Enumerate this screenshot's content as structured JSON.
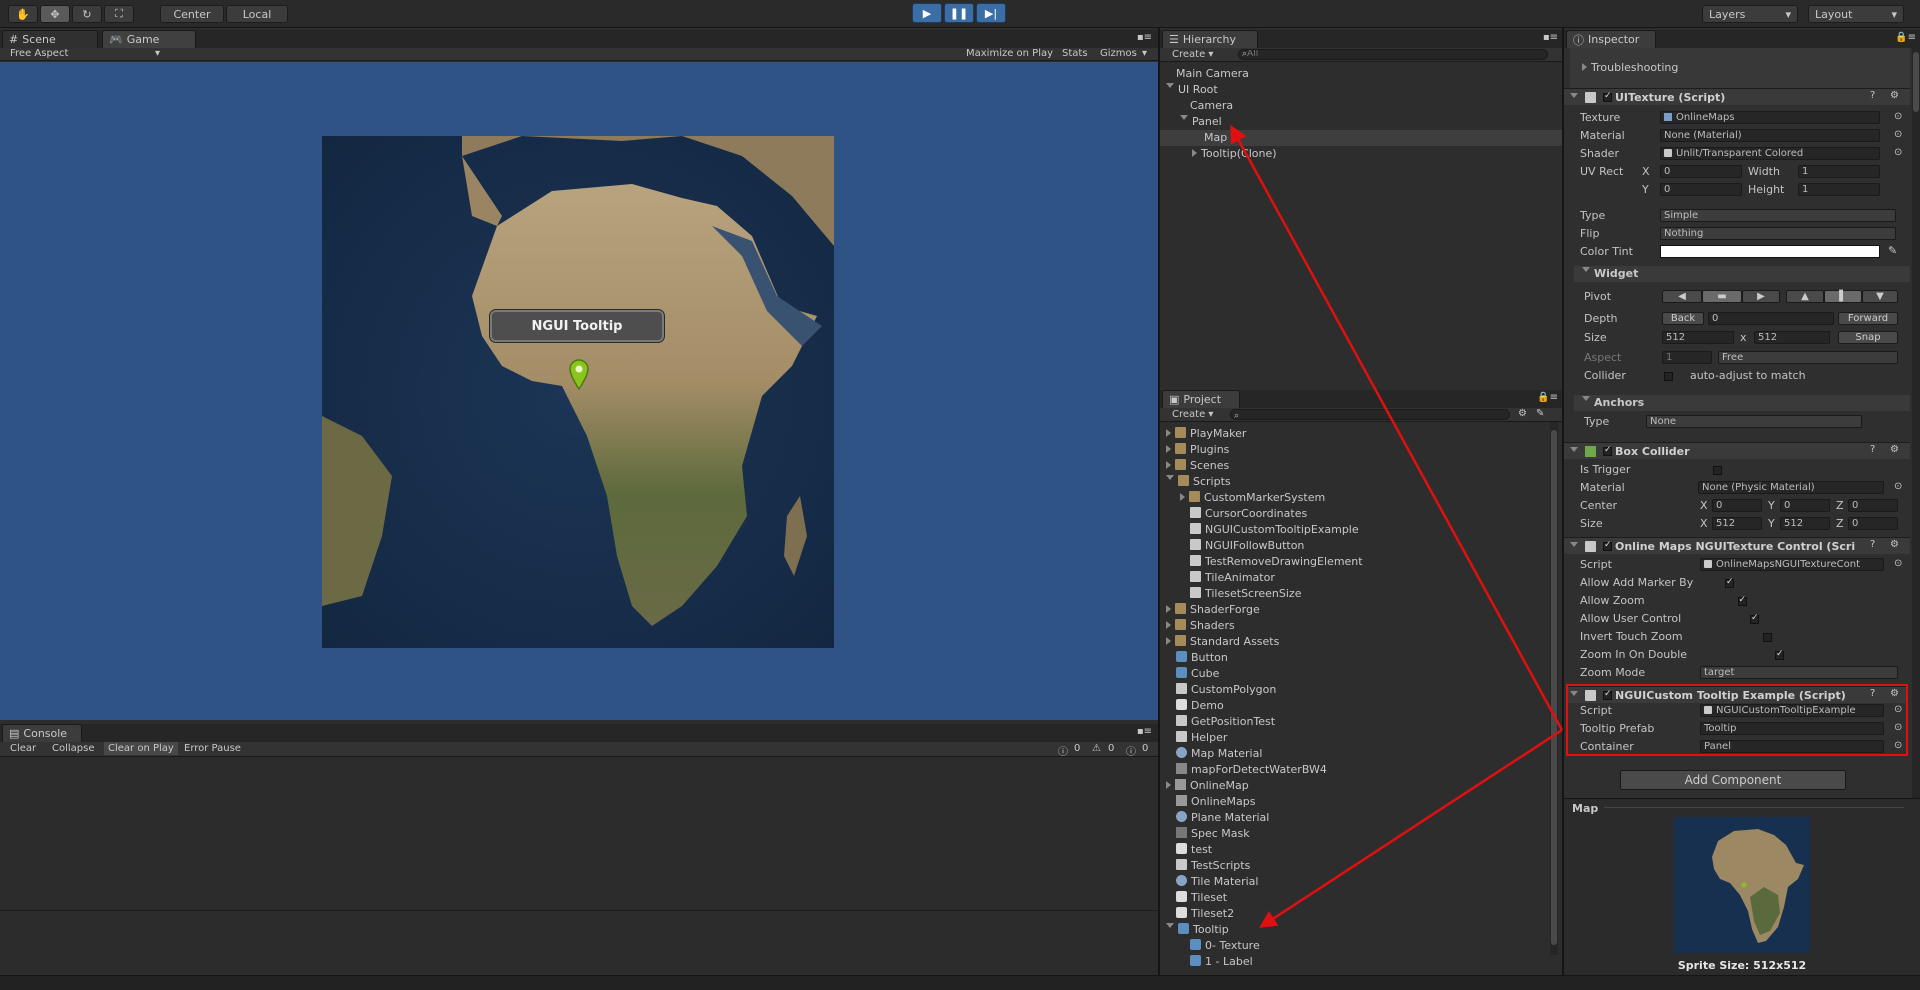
{
  "toolbar": {
    "center": "Center",
    "local": "Local",
    "layers": "Layers",
    "layout": "Layout"
  },
  "scene": {
    "tab_scene": "Scene",
    "tab_game": "Game",
    "aspect": "Free Aspect",
    "maximize": "Maximize on Play",
    "stats": "Stats",
    "gizmos": "Gizmos",
    "tooltip": "NGUI Tooltip"
  },
  "console": {
    "tab": "Console",
    "clear": "Clear",
    "collapse": "Collapse",
    "clear_on_play": "Clear on Play",
    "error_pause": "Error Pause",
    "count_log": "0",
    "count_warn": "0",
    "count_err": "0"
  },
  "hierarchy": {
    "tab": "Hierarchy",
    "create": "Create",
    "search_placeholder": "All",
    "items": [
      "Main Camera",
      "UI Root",
      "Camera",
      "Panel",
      "Map",
      "Tooltip(Clone)"
    ]
  },
  "project": {
    "tab": "Project",
    "create": "Create",
    "items": [
      "PlayMaker",
      "Plugins",
      "Scenes",
      "Scripts",
      "CustomMarkerSystem",
      "CursorCoordinates",
      "NGUICustomTooltipExample",
      "NGUIFollowButton",
      "TestRemoveDrawingElement",
      "TileAnimator",
      "TilesetScreenSize",
      "ShaderForge",
      "Shaders",
      "Standard Assets",
      "Button",
      "Cube",
      "CustomPolygon",
      "Demo",
      "GetPositionTest",
      "Helper",
      "Map Material",
      "mapForDetectWaterBW4",
      "OnlineMap",
      "OnlineMaps",
      "Plane Material",
      "Spec Mask",
      "test",
      "TestScripts",
      "Tile Material",
      "Tileset",
      "Tileset2",
      "Tooltip",
      "0- Texture",
      "1 - Label"
    ]
  },
  "inspector": {
    "tab": "Inspector",
    "troubleshooting": "Troubleshooting",
    "uitexture": {
      "title": "UITexture (Script)",
      "texture_l": "Texture",
      "texture_v": "OnlineMaps",
      "material_l": "Material",
      "material_v": "None (Material)",
      "shader_l": "Shader",
      "shader_v": "Unlit/Transparent Colored",
      "uvrect_l": "UV Rect",
      "x_l": "X",
      "x_v": "0",
      "y_l": "Y",
      "y_v": "0",
      "w_l": "Width",
      "w_v": "1",
      "h_l": "Height",
      "h_v": "1",
      "type_l": "Type",
      "type_v": "Simple",
      "flip_l": "Flip",
      "flip_v": "Nothing",
      "tint_l": "Color Tint"
    },
    "widget": {
      "title": "Widget",
      "pivot_l": "Pivot",
      "depth_l": "Depth",
      "back": "Back",
      "depth_v": "0",
      "forward": "Forward",
      "size_l": "Size",
      "size_w": "512",
      "x_sep": "x",
      "size_h": "512",
      "snap": "Snap",
      "aspect_l": "Aspect",
      "aspect_v": "1",
      "aspect_mode": "Free",
      "collider_l": "Collider",
      "collider_v": "auto-adjust to match"
    },
    "anchors": {
      "title": "Anchors",
      "type_l": "Type",
      "type_v": "None"
    },
    "box": {
      "title": "Box Collider",
      "trigger_l": "Is Trigger",
      "material_l": "Material",
      "material_v": "None (Physic Material)",
      "center_l": "Center",
      "size_l": "Size",
      "cx": "0",
      "cy": "0",
      "cz": "0",
      "sx": "512",
      "sy": "512",
      "sz": "0",
      "xl": "X",
      "yl": "Y",
      "zl": "Z"
    },
    "omc": {
      "title": "Online Maps NGUITexture Control (Scri",
      "script_l": "Script",
      "script_v": "OnlineMapsNGUITextureCont",
      "add_marker_l": "Allow Add Marker By",
      "allow_zoom_l": "Allow Zoom",
      "allow_user_l": "Allow User Control",
      "invert_l": "Invert Touch Zoom",
      "zoom_double_l": "Zoom In On Double",
      "zoom_mode_l": "Zoom Mode",
      "zoom_mode_v": "target"
    },
    "ttip": {
      "title": "NGUICustom Tooltip Example (Script)",
      "script_l": "Script",
      "script_v": "NGUICustomTooltipExample",
      "prefab_l": "Tooltip Prefab",
      "prefab_v": "Tooltip",
      "container_l": "Container",
      "container_v": "Panel"
    },
    "add_component": "Add Component",
    "preview_title": "Map",
    "sprite_size": "Sprite Size: 512x512"
  },
  "colors": {
    "accent": "#3b6ea5",
    "highlight_red": "#e01010",
    "scene_bg": "#2f5385"
  }
}
